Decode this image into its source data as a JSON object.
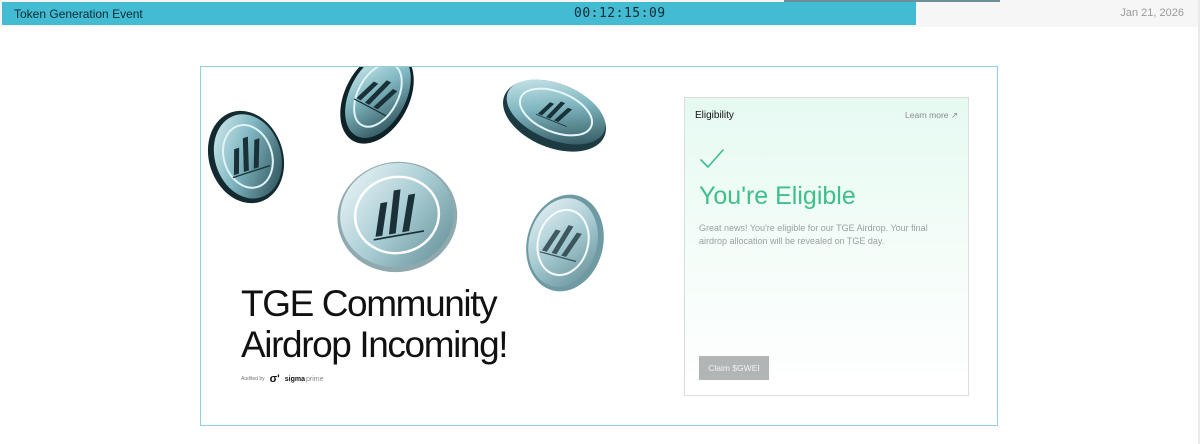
{
  "topbar": {
    "title": "Token Generation Event",
    "countdown": "00:12:15:09",
    "date": "Jan 21, 2026"
  },
  "hero": {
    "headline_line1": "TGE Community",
    "headline_line2": "Airdrop Incoming!",
    "audited_label": "Audited by",
    "auditor_mark": "σ'",
    "auditor_name": "sigma",
    "auditor_suffix": "prime"
  },
  "eligibility": {
    "title": "Eligibility",
    "learn_more": "Learn more ↗",
    "status": "You're Eligible",
    "description": "Great news! You're eligible for our TGE Airdrop. Your final airdrop allocation will be revealed on TGE day.",
    "claim_label": "Claim $GWEI"
  },
  "colors": {
    "topbar_accent": "#43bcd3",
    "eligible_green": "#3ebf8b",
    "card_border": "#8ed0dd",
    "claim_disabled": "#b1b5b6"
  },
  "icons": [
    "check-icon",
    "coin-icon"
  ]
}
